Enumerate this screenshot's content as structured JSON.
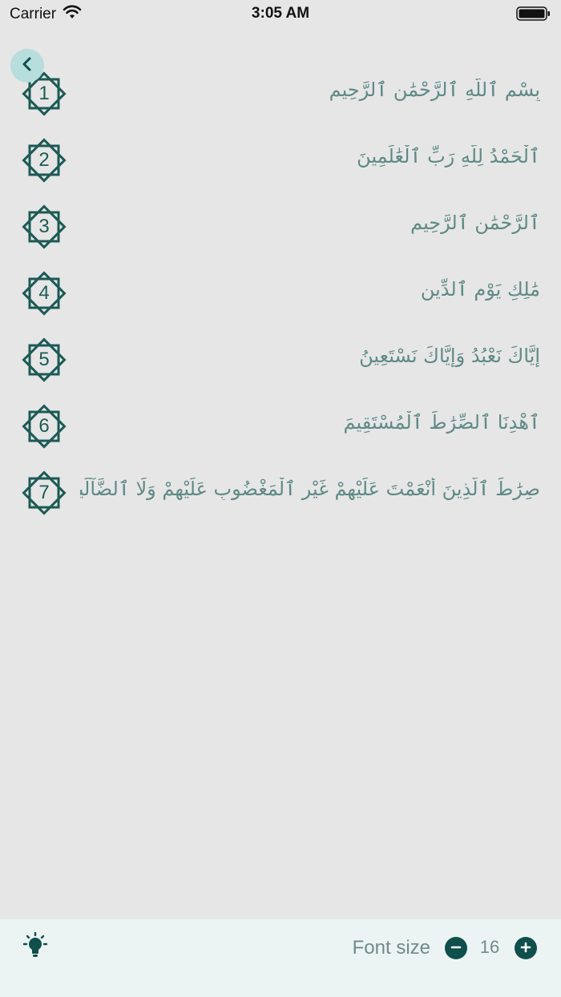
{
  "status_bar": {
    "carrier": "Carrier",
    "time": "3:05 AM"
  },
  "verses": [
    {
      "number": "1",
      "text": "بِسْمِ ٱللَّهِ ٱلرَّحْمَٰنِ ٱلرَّحِيمِ"
    },
    {
      "number": "2",
      "text": "ٱلْحَمْدُ لِلَّهِ رَبِّ ٱلْعَٰلَمِينَ"
    },
    {
      "number": "3",
      "text": "ٱلرَّحْمَٰنِ ٱلرَّحِيمِ"
    },
    {
      "number": "4",
      "text": "مَٰلِكِ يَوْمِ ٱلدِّينِ"
    },
    {
      "number": "5",
      "text": "إِيَّاكَ نَعْبُدُ وَإِيَّاكَ نَسْتَعِينُ"
    },
    {
      "number": "6",
      "text": "ٱهْدِنَا ٱلصِّرَٰطَ ٱلْمُسْتَقِيمَ"
    },
    {
      "number": "7",
      "text": "صِرَٰطَ ٱلَّذِينَ أَنْعَمْتَ عَلَيْهِمْ غَيْرِ ٱلْمَغْضُوبِ عَلَيْهِمْ وَلَا ٱلضَّآلِّينَ"
    }
  ],
  "toolbar": {
    "font_size_label": "Font size",
    "font_size_value": "16"
  },
  "icons": {
    "back": "chevron-left-icon",
    "wifi": "wifi-icon",
    "battery": "battery-icon",
    "bulb": "lightbulb-icon",
    "minus": "minus-circle-icon",
    "plus": "plus-circle-icon"
  },
  "colors": {
    "accent": "#0f4f4c",
    "verse_text": "#5f8a86",
    "badge_stroke": "#1c5a55",
    "back_button_bg": "#b7dddd",
    "background": "#e6e6e6",
    "toolbar_bg": "#ecf4f3"
  }
}
